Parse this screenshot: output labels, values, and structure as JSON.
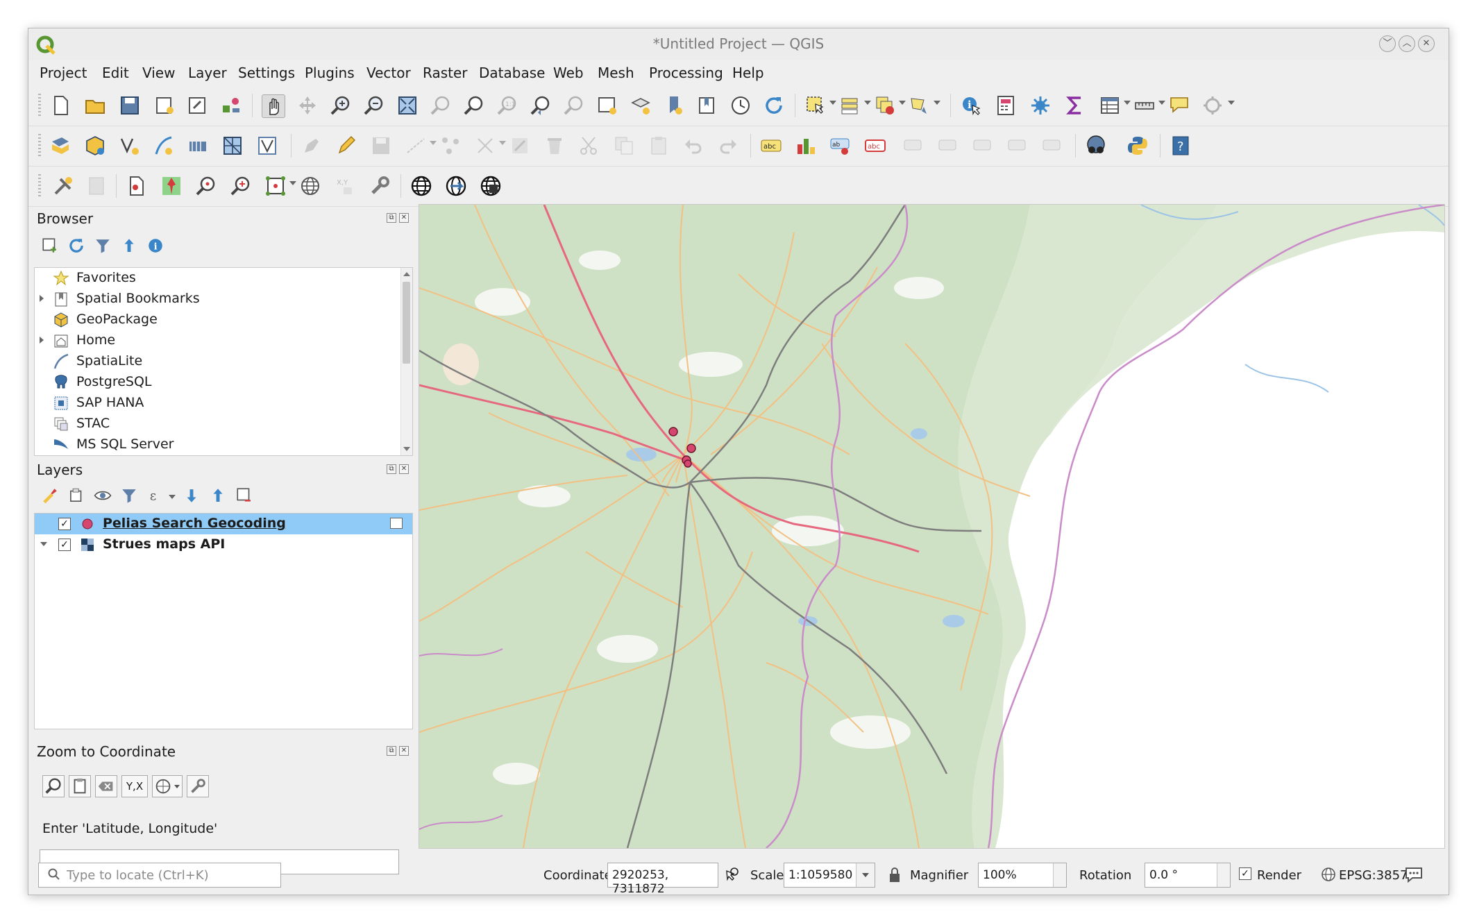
{
  "window": {
    "title": "*Untitled Project — QGIS"
  },
  "menu": [
    "Project",
    "Edit",
    "View",
    "Layer",
    "Settings",
    "Plugins",
    "Vector",
    "Raster",
    "Database",
    "Web",
    "Mesh",
    "Processing",
    "Help"
  ],
  "browser": {
    "title": "Browser",
    "items": [
      {
        "label": "Favorites",
        "icon": "star-icon",
        "expandable": false
      },
      {
        "label": "Spatial Bookmarks",
        "icon": "bookmark-icon",
        "expandable": true
      },
      {
        "label": "GeoPackage",
        "icon": "geopackage-icon",
        "expandable": false
      },
      {
        "label": "Home",
        "icon": "home-icon",
        "expandable": true
      },
      {
        "label": "SpatiaLite",
        "icon": "spatialite-icon",
        "expandable": false
      },
      {
        "label": "PostgreSQL",
        "icon": "postgresql-icon",
        "expandable": false
      },
      {
        "label": "SAP HANA",
        "icon": "sap-hana-icon",
        "expandable": false
      },
      {
        "label": "STAC",
        "icon": "stac-icon",
        "expandable": false
      },
      {
        "label": "MS SQL Server",
        "icon": "mssql-icon",
        "expandable": false
      }
    ]
  },
  "layers": {
    "title": "Layers",
    "items": [
      {
        "label": "Pelias Search Geocoding",
        "checked": true,
        "selected": true,
        "symbol": "point-symbol-icon"
      },
      {
        "label": "Strues maps API",
        "checked": true,
        "selected": false,
        "symbol": "raster-tile-icon"
      }
    ]
  },
  "zoom_to_coordinate": {
    "title": "Zoom to Coordinate",
    "yx_label": "Y,X",
    "prompt": "Enter 'Latitude, Longitude'",
    "value": ""
  },
  "status": {
    "locator_placeholder": "Type to locate (Ctrl+K)",
    "coordinate_label": "Coordinate",
    "coordinate_value": "2920253, 7311872",
    "scale_label": "Scale",
    "scale_value": "1:1059580",
    "magnifier_label": "Magnifier",
    "magnifier_value": "100%",
    "rotation_label": "Rotation",
    "rotation_value": "0.0 °",
    "render_label": "Render",
    "render_checked": true,
    "crs": "EPSG:3857"
  },
  "colors": {
    "accent_selected": "#8fcbf6",
    "map_forest": "#cfe1c5",
    "map_road_major": "#e6687e",
    "map_road": "#f2c083",
    "map_rail": "#7d7d7d",
    "map_border": "#c98cc9",
    "map_point": "#d6476f"
  }
}
